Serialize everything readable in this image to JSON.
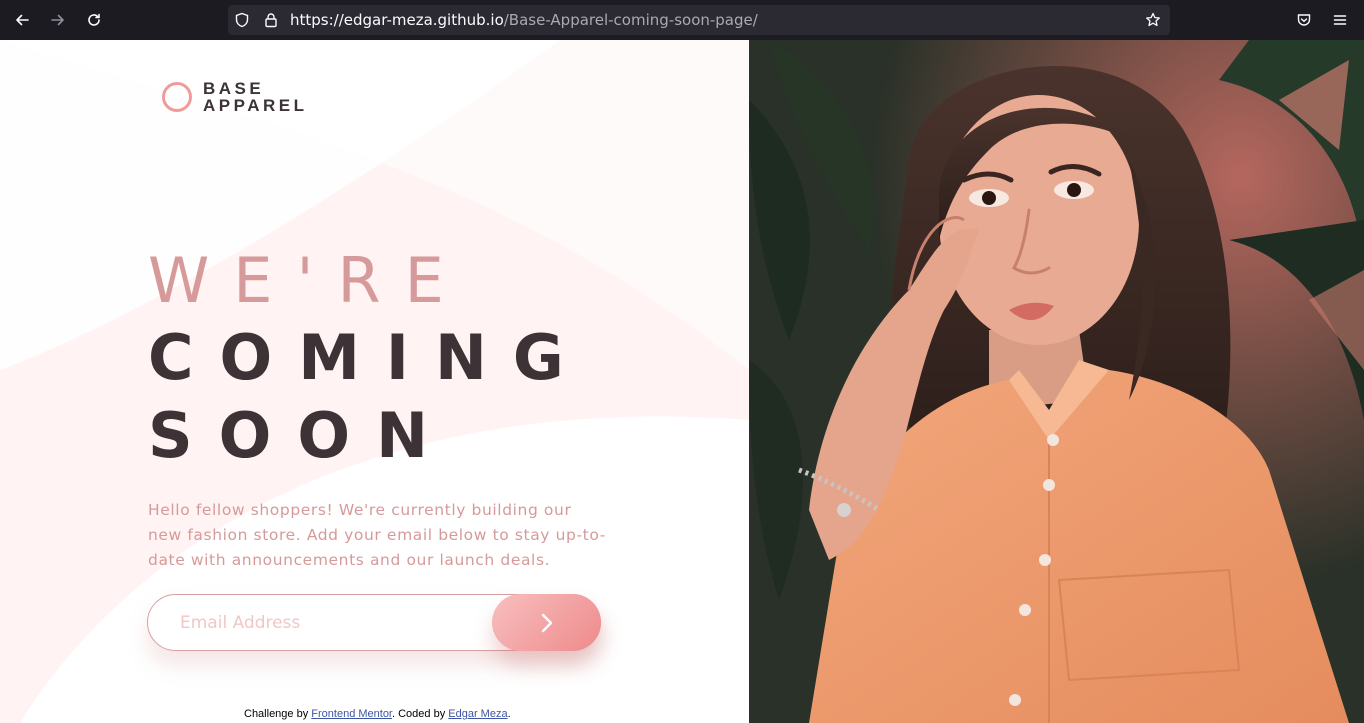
{
  "browser": {
    "url_host": "https://edgar-meza.github.io",
    "url_path": "/Base-Apparel-coming-soon-page/"
  },
  "logo": {
    "line1": "BASE",
    "line2": "APPAREL"
  },
  "hero": {
    "line1": "WE'RE",
    "line2": "COMING",
    "line3": "SOON"
  },
  "intro": "Hello fellow shoppers! We're currently building our new fashion store. Add your email below to stay up-to-date with announcements and our launch deals.",
  "form": {
    "email_placeholder": "Email Address"
  },
  "attribution": {
    "prefix": "Challenge by ",
    "link1": "Frontend Mentor",
    "middle": ". Coded by ",
    "link2": "Edgar Meza",
    "suffix": "."
  },
  "colors": {
    "accent": "#ee8a8b",
    "text_pink": "#d69a9a",
    "text_dark": "#3d3336"
  },
  "icons": [
    "back-icon",
    "forward-icon",
    "reload-icon",
    "shield-icon",
    "lock-icon",
    "bookmark-star-icon",
    "pocket-icon",
    "menu-icon",
    "chevron-right-icon"
  ]
}
